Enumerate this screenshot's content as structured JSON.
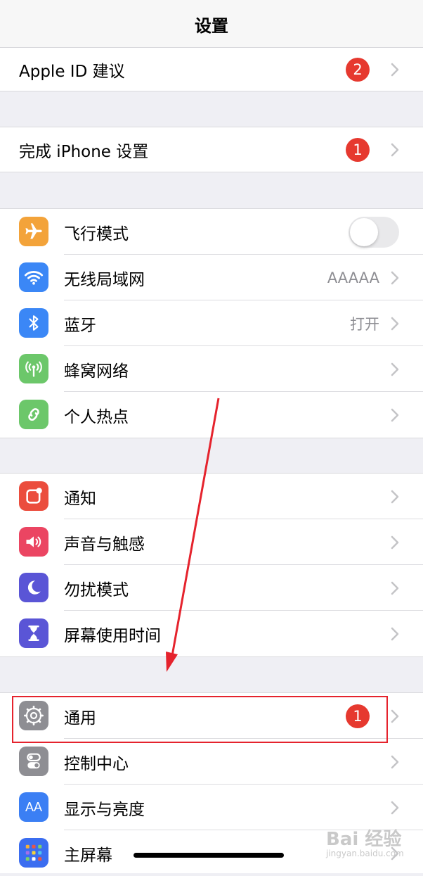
{
  "nav": {
    "title": "设置"
  },
  "apple_id": {
    "label": "Apple ID 建议",
    "badge": "2"
  },
  "iphone_setup": {
    "label": "完成 iPhone 设置",
    "badge": "1"
  },
  "connectivity": [
    {
      "label": "飞行模式",
      "icon": "airplane-icon",
      "color": "#f3a33a",
      "toggle": false
    },
    {
      "label": "无线局域网",
      "icon": "wifi-icon",
      "color": "#3b87f6",
      "value": "AAAAA"
    },
    {
      "label": "蓝牙",
      "icon": "bluetooth-icon",
      "color": "#3b87f6",
      "value": "打开"
    },
    {
      "label": "蜂窝网络",
      "icon": "cellular-icon",
      "color": "#6cc76a"
    },
    {
      "label": "个人热点",
      "icon": "hotspot-icon",
      "color": "#6cc76a"
    }
  ],
  "notifications": [
    {
      "label": "通知",
      "icon": "notifications-icon",
      "color": "#eb4d3d"
    },
    {
      "label": "声音与触感",
      "icon": "sound-icon",
      "color": "#eb4562"
    },
    {
      "label": "勿扰模式",
      "icon": "moon-icon",
      "color": "#5a55d6"
    },
    {
      "label": "屏幕使用时间",
      "icon": "hourglass-icon",
      "color": "#5a55d6"
    }
  ],
  "general": [
    {
      "label": "通用",
      "icon": "gear-icon",
      "color": "#8e8e93",
      "badge": "1"
    },
    {
      "label": "控制中心",
      "icon": "control-center-icon",
      "color": "#8e8e93"
    },
    {
      "label": "显示与亮度",
      "icon": "display-icon",
      "color": "#3b7ff4",
      "glyph": "AA"
    },
    {
      "label": "主屏幕",
      "icon": "home-screen-icon",
      "color": "#3b6df0"
    }
  ],
  "watermark": {
    "main": "Bai 经验",
    "sub": "jingyan.baidu.com"
  }
}
